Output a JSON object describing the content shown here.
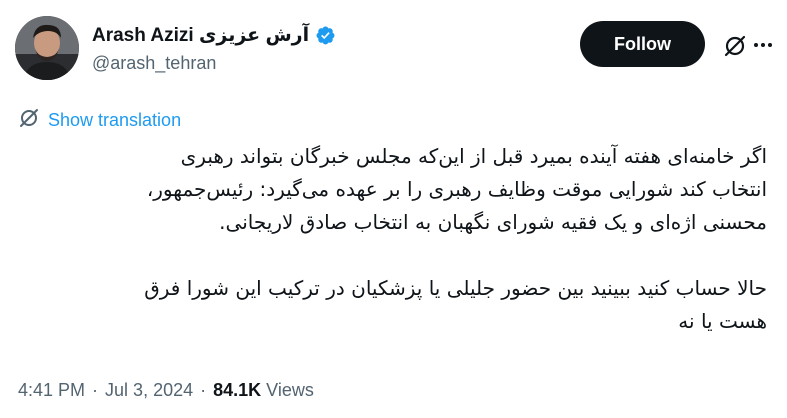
{
  "author": {
    "display_name_rtl": "آرش عزیزی",
    "display_name_latin": "Arash Azizi",
    "handle": "@arash_tehran"
  },
  "actions": {
    "follow_label": "Follow"
  },
  "icons": {
    "verified": "verified-badge-icon",
    "grok": "grok-icon",
    "more": "more-options-icon",
    "translate": "translate-icon"
  },
  "colors": {
    "accent": "#1d9bf0",
    "text": "#0f1419",
    "muted": "#536471",
    "follow_bg": "#0f1419"
  },
  "translation_label": "Show translation",
  "tweet": {
    "paragraph1_lines": [
      "اگر خامنه‌ای هفته آینده بمیرد قبل از این‌که مجلس خبرگان بتواند رهبری",
      "انتخاب کند شورایی موقت وظایف رهبری را بر عهده می‌گیرد: رئیس‌جمهور،",
      "محسنی اژه‌ای و یک فقیه شورای نگهبان به انتخاب صادق لاریجانی."
    ],
    "paragraph2_lines": [
      "حالا حساب کنید ببینید بین حضور جلیلی یا پزشکیان در ترکیب این شورا فرق",
      "هست یا نه"
    ]
  },
  "meta": {
    "time": "4:41 PM",
    "separator": "·",
    "date": "Jul 3, 2024",
    "views_count": "84.1K",
    "views_label": "Views"
  }
}
